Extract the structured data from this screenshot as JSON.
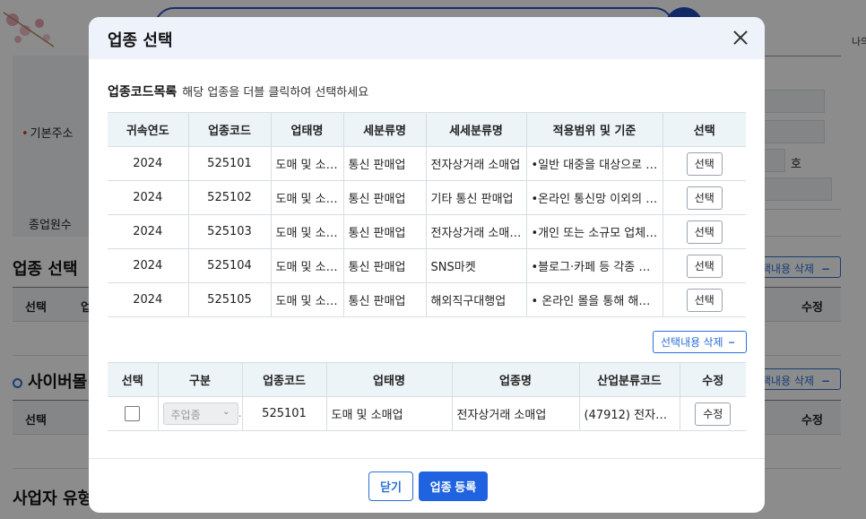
{
  "background": {
    "user_text": "나의",
    "base_address_label": "기본주소",
    "ho_label": "호",
    "employee_count_label": "종업원수",
    "section_business_title": "업종 선택",
    "section_cyber_title": "사이버몰(신",
    "section_type_title": "사업자 유형",
    "delete_label": "택내용 삭제",
    "col_select": "선택",
    "col_code_partial": "업",
    "col_edit": "수정"
  },
  "modal": {
    "title": "업종 선택",
    "list_title": "업종코드목록",
    "list_hint": "해당 업종을 더블 클릭하여 선택하세요",
    "list_columns": [
      "귀속연도",
      "업종코드",
      "업태명",
      "세분류명",
      "세세분류명",
      "적용범위 및 기준",
      "선택"
    ],
    "list_rows": [
      {
        "year": "2024",
        "code": "525101",
        "biz": "도매 및 소…",
        "sub": "통신 판매업",
        "subsub": "전자상거래 소매업",
        "scope": "•일반 대중을 대상으로 …",
        "btn": "선택"
      },
      {
        "year": "2024",
        "code": "525102",
        "biz": "도매 및 소…",
        "sub": "통신 판매업",
        "subsub": "기타 통신 판매업",
        "scope": "•온라인 통신망 이외의 …",
        "btn": "선택"
      },
      {
        "year": "2024",
        "code": "525103",
        "biz": "도매 및 소…",
        "sub": "통신 판매업",
        "subsub": "전자상거래 소매 …",
        "scope": "•개인 또는 소규모 업체…",
        "btn": "선택"
      },
      {
        "year": "2024",
        "code": "525104",
        "biz": "도매 및 소…",
        "sub": "통신 판매업",
        "subsub": "SNS마켓",
        "scope": "•블로그·카페 등 각종 사…",
        "btn": "선택"
      },
      {
        "year": "2024",
        "code": "525105",
        "biz": "도매 및 소…",
        "sub": "통신 판매업",
        "subsub": "해외직구대행업",
        "scope": "• 온라인 몰을 통해 해외…",
        "btn": "선택"
      }
    ],
    "delete_button": "선택내용 삭제",
    "selected_columns": [
      "선택",
      "구분",
      "업종코드",
      "업태명",
      "업종명",
      "산업분류코드",
      "수정"
    ],
    "selected_rows": [
      {
        "type": "주업종",
        "code": "525101",
        "biz": "도매 및 소매업",
        "name": "전자상거래 소매업",
        "industry": "(47912) 전자상…",
        "btn": "수정"
      }
    ],
    "close_button": "닫기",
    "register_button": "업종 등록"
  }
}
